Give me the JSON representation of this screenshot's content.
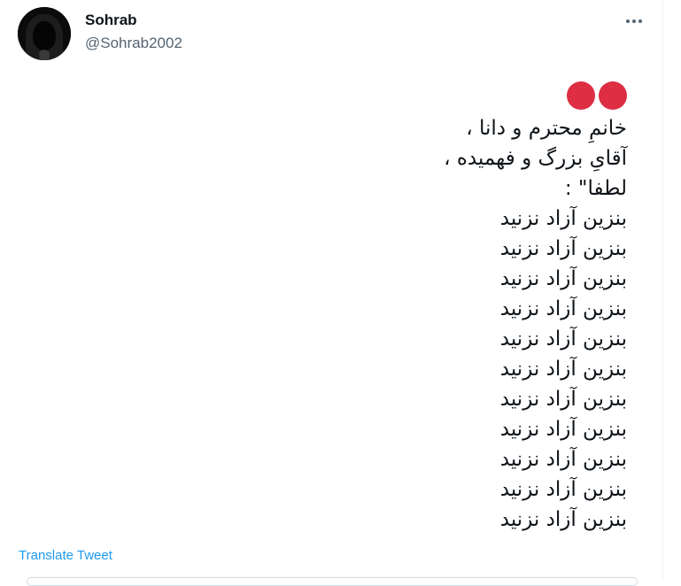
{
  "tweet": {
    "author": {
      "name": "Sohrab",
      "handle": "@Sohrab2002",
      "avatar_icon": "hooded-figure-avatar"
    },
    "more_icon": "more-horizontal-icon",
    "emoji": [
      "red-circle",
      "red-circle"
    ],
    "emoji_color": "#dd2e44",
    "lines": [
      "خانمِ محترم و دانا ،",
      "آقایِ بزرگ و فهمیده ،",
      "لطفا\" :",
      "بنزین آزاد نزنید",
      "بنزین آزاد نزنید",
      "بنزین آزاد نزنید",
      "بنزین آزاد نزنید",
      "بنزین آزاد نزنید",
      "بنزین آزاد نزنید",
      "بنزین آزاد نزنید",
      "بنزین آزاد نزنید",
      "بنزین آزاد نزنید",
      "بنزین آزاد نزنید",
      "بنزین آزاد نزنید"
    ],
    "translate_label": "Translate Tweet"
  },
  "colors": {
    "accent": "#1d9bf0",
    "text": "#0f1419",
    "secondary_text": "#536471"
  }
}
